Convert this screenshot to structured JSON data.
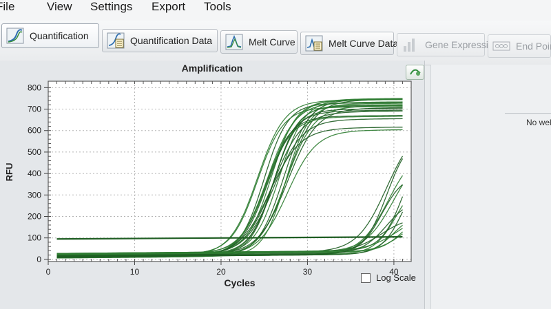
{
  "menu": {
    "items": [
      "File",
      "View",
      "Settings",
      "Export",
      "Tools"
    ]
  },
  "toolbar": {
    "tabs": [
      {
        "label": "Quantification",
        "icon": "amplification-curve-icon",
        "active": true,
        "enabled": true
      },
      {
        "label": "Quantification Data",
        "icon": "data-sheet-icon",
        "active": false,
        "enabled": true
      },
      {
        "label": "Melt Curve",
        "icon": "melt-curve-icon",
        "active": false,
        "enabled": true
      },
      {
        "label": "Melt Curve Data",
        "icon": "melt-data-sheet-icon",
        "active": false,
        "enabled": true
      },
      {
        "label": "Gene Expression",
        "icon": "bar-chart-icon",
        "active": false,
        "enabled": false
      },
      {
        "label": "End Point",
        "icon": "plate-wells-icon",
        "active": false,
        "enabled": false
      }
    ]
  },
  "chart_panel": {
    "log_scale_label": "Log Scale",
    "log_scale_checked": false
  },
  "right_panel": {
    "message": "No wells"
  },
  "colors": {
    "curve": "#2f7d32",
    "curve_dark": "#1f5e23",
    "grid": "#b5b5b5"
  },
  "chart_data": {
    "type": "line",
    "title": "Amplification",
    "xlabel": "Cycles",
    "ylabel": "RFU",
    "xlim": [
      0,
      42
    ],
    "ylim": [
      -10,
      830
    ],
    "xticks": [
      0,
      10,
      20,
      30,
      40
    ],
    "yticks": [
      0,
      100,
      200,
      300,
      400,
      500,
      600,
      700,
      800
    ],
    "grid": true,
    "log_scale": false,
    "threshold": 100,
    "series_groups": [
      {
        "description": "early amplification curves",
        "count": 22,
        "plateau_range": [
          590,
          745
        ],
        "midpoint_cycle_range": [
          24,
          28
        ],
        "baseline_range": [
          5,
          25
        ]
      },
      {
        "description": "late amplification curves",
        "count": 14,
        "plateau_range": [
          150,
          620
        ],
        "midpoint_cycle_range": [
          38.5,
          41.5
        ],
        "baseline_range": [
          10,
          30
        ]
      }
    ]
  }
}
